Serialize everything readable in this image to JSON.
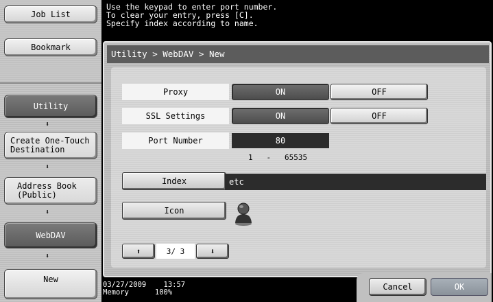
{
  "sidebar": {
    "job_list": "Job List",
    "bookmark": "Bookmark",
    "utility": "Utility",
    "create_one_touch": "Create One-Touch\nDestination",
    "address_book": "Address Book\n(Public)",
    "webdav": "WebDAV",
    "new": "New",
    "arrow_glyph": "⬇"
  },
  "message": {
    "line1": "Use the keypad to enter port number.",
    "line2": "To clear your entry, press [C].",
    "line3": "Specify index according to name."
  },
  "breadcrumb": "Utility > WebDAV > New",
  "proxy": {
    "label": "Proxy",
    "on": "ON",
    "off": "OFF",
    "selected": "ON"
  },
  "ssl": {
    "label": "SSL Settings",
    "on": "ON",
    "off": "OFF",
    "selected": "ON"
  },
  "port": {
    "label": "Port Number",
    "value": "80",
    "range_min": "1",
    "range_sep": "-",
    "range_max": "65535"
  },
  "index": {
    "label": "Index",
    "value": "etc"
  },
  "icon": {
    "label": "Icon",
    "icon_name": "person-icon"
  },
  "pager": {
    "up_glyph": "⬆",
    "down_glyph": "⬇",
    "text": "3/ 3"
  },
  "footer": {
    "date": "03/27/2009",
    "time": "13:57",
    "memory_label": "Memory",
    "memory_value": "100%"
  },
  "actions": {
    "cancel": "Cancel",
    "ok": "OK"
  },
  "colors": {
    "selected": "#555555",
    "dark_field": "#2c2c2c",
    "ok_bg": "#9aa2aa"
  }
}
